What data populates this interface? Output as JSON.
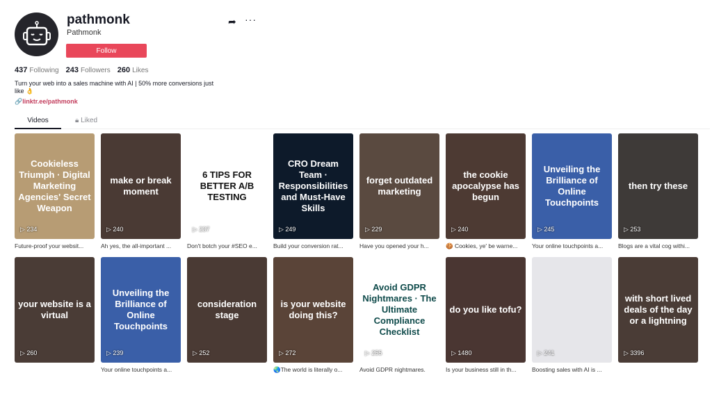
{
  "profile": {
    "username": "pathmonk",
    "nickname": "Pathmonk",
    "follow_label": "Follow",
    "following": "437",
    "following_label": "Following",
    "followers": "243",
    "followers_label": "Followers",
    "likes": "260",
    "likes_label": "Likes",
    "bio": "Turn your web into a sales machine with AI | 50% more conversions just like 👌",
    "link": "linktr.ee/pathmonk"
  },
  "tabs": [
    {
      "label": "Videos"
    },
    {
      "label": "Liked"
    }
  ],
  "videos": [
    {
      "overlay": "Cookieless Triumph · Digital Marketing Agencies' Secret Weapon",
      "views": "234",
      "caption": "Future-proof your websit...",
      "bg": "#b79c74"
    },
    {
      "overlay": "make or break moment",
      "views": "240",
      "caption": "Ah yes, the all-important ...",
      "bg": "#4a3a34"
    },
    {
      "overlay": "6 TIPS FOR BETTER A/B TESTING",
      "views": "237",
      "caption": "Don't botch your #SEO e...",
      "bg": "#ffffff"
    },
    {
      "overlay": "CRO Dream Team · Responsibilities and Must-Have Skills",
      "views": "249",
      "caption": "Build your conversion rat...",
      "bg": "#0d1a2a"
    },
    {
      "overlay": "forget outdated marketing",
      "views": "229",
      "caption": "Have you opened your h...",
      "bg": "#5a4a40"
    },
    {
      "overlay": "the cookie apocalypse has begun",
      "views": "240",
      "caption": "🍪 Cookies, ye' be warne...",
      "bg": "#4d3a33"
    },
    {
      "overlay": "Unveiling the Brilliance of Online Touchpoints",
      "views": "245",
      "caption": "Your online touchpoints a...",
      "bg": "#3a5fa8"
    },
    {
      "overlay": "then try these",
      "views": "253",
      "caption": "Blogs are a vital cog withi...",
      "bg": "#3e3a38"
    },
    {
      "overlay": "your website is a virtual",
      "views": "260",
      "caption": "",
      "bg": "#4a3c36"
    },
    {
      "overlay": "Unveiling the Brilliance of Online Touchpoints",
      "views": "239",
      "caption": "Your online touchpoints a...",
      "bg": "#3a5fa8"
    },
    {
      "overlay": "consideration stage",
      "views": "252",
      "caption": "",
      "bg": "#4a3a34"
    },
    {
      "overlay": "is your website doing this?",
      "views": "272",
      "caption": "🌏The world is literally o...",
      "bg": "#5a4438"
    },
    {
      "overlay": "Avoid GDPR Nightmares · The Ultimate Compliance Checklist",
      "views": "255",
      "caption": "Avoid GDPR nightmares.",
      "bg": "#ffffff"
    },
    {
      "overlay": "do you like tofu?",
      "views": "1480",
      "caption": "Is your business still in th...",
      "bg": "#4a3632"
    },
    {
      "overlay": "",
      "views": "241",
      "caption": "Boosting sales with AI is ...",
      "bg": "#e6e6ea"
    },
    {
      "overlay": "with short lived deals of the day or a lightning",
      "views": "3396",
      "caption": "",
      "bg": "#4a3c36"
    }
  ],
  "icons": {
    "share": "share-arrow-icon",
    "more": "more-dots-icon",
    "lock": "lock-icon",
    "link": "link-icon",
    "play": "play-icon"
  }
}
